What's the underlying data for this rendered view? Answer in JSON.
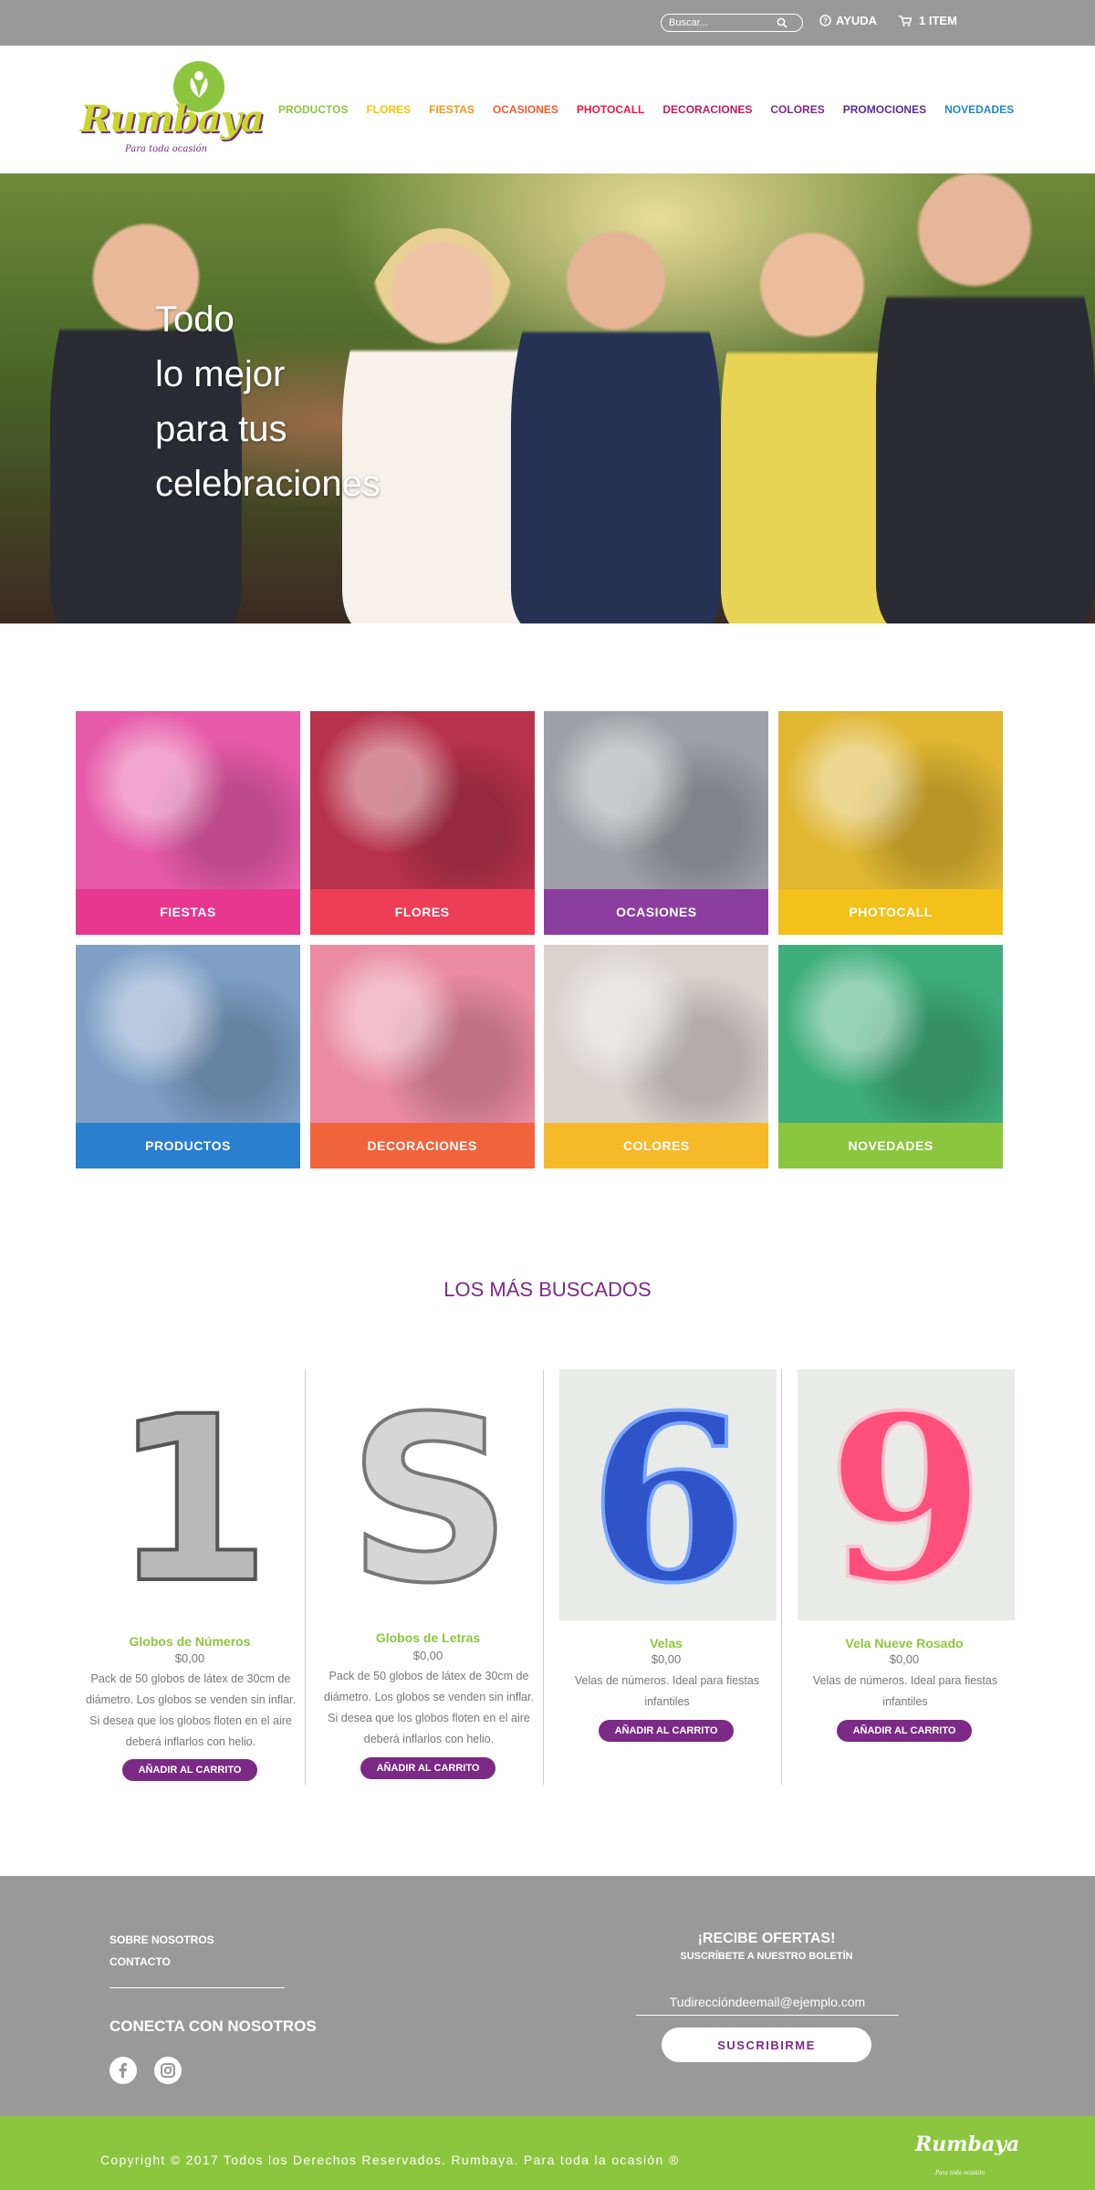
{
  "topbar": {
    "search_placeholder": "Buscar...",
    "help_label": "AYUDA",
    "cart_label": "1 ITEM",
    "icons": [
      "search-icon",
      "help-icon",
      "cart-icon"
    ]
  },
  "brand": {
    "name": "Rumbaya",
    "tagline": "Para toda ocasión",
    "colors": {
      "purple": "#7b2a85",
      "green": "#8cc63f",
      "lime": "#c7d62b",
      "gray": "#999999"
    }
  },
  "nav": [
    {
      "label": "PRODUCTOS",
      "color": "#8cc63f"
    },
    {
      "label": "FLORES",
      "color": "#f5c400"
    },
    {
      "label": "FIESTAS",
      "color": "#f7941d"
    },
    {
      "label": "OCASIONES",
      "color": "#f15a29"
    },
    {
      "label": "PHOTOCALL",
      "color": "#e8174a"
    },
    {
      "label": "DECORACIONES",
      "color": "#c2185b"
    },
    {
      "label": "COLORES",
      "color": "#7b2a85"
    },
    {
      "label": "PROMOCIONES",
      "color": "#5c2d91"
    },
    {
      "label": "NOVEDADES",
      "color": "#1e88c7"
    }
  ],
  "hero": {
    "lines": [
      "Todo",
      "lo mejor",
      "para tus",
      "celebraciones"
    ]
  },
  "categories": [
    {
      "label": "FIESTAS",
      "band": "#e8378f",
      "img": "#e65aa8"
    },
    {
      "label": "FLORES",
      "band": "#ee3d57",
      "img": "#b7324b"
    },
    {
      "label": "OCASIONES",
      "band": "#8c3ea0",
      "img": "#9fa0a6"
    },
    {
      "label": "PHOTOCALL",
      "band": "#f2c21a",
      "img": "#e0b632"
    },
    {
      "label": "PRODUCTOS",
      "band": "#2a7fce",
      "img": "#7f9fc7"
    },
    {
      "label": "DECORACIONES",
      "band": "#f1633a",
      "img": "#ea8aa3"
    },
    {
      "label": "COLORES",
      "band": "#f6b92a",
      "img": "#d9d3d0"
    },
    {
      "label": "NOVEDADES",
      "band": "#8cc63f",
      "img": "#3fae7c"
    }
  ],
  "featured": {
    "title": "LOS MÁS BUSCADOS",
    "products": [
      {
        "name": "Globos de Números",
        "price": "$0,00",
        "desc": "Pack de 50 globos de látex de 30cm de diámetro. Los globos se venden sin inflar. Si desea que los globos floten en el aire deberá inflarlos con helio.",
        "button": "AÑADIR AL CARRITO",
        "glyph": "1"
      },
      {
        "name": "Globos de Letras",
        "price": "$0,00",
        "desc": "Pack de 50 globos de látex de 30cm de diámetro. Los globos se venden sin inflar. Si desea que los globos floten en el aire deberá inflarlos con helio.",
        "button": "AÑADIR AL CARRITO",
        "glyph": "S"
      },
      {
        "name": "Velas",
        "price": "$0,00",
        "desc": "Velas de números. Ideal para fiestas infantiles",
        "button": "AÑADIR AL CARRITO",
        "glyph": "6"
      },
      {
        "name": "Vela Nueve Rosado",
        "price": "$0,00",
        "desc": "Velas de números. Ideal para fiestas infantiles",
        "button": "AÑADIR AL CARRITO",
        "glyph": "9"
      }
    ]
  },
  "footer": {
    "links": [
      "SOBRE NOSOTROS",
      "CONTACTO"
    ],
    "connect": "CONECTA CON NOSOTROS",
    "social": [
      "facebook-icon",
      "instagram-icon"
    ],
    "offers_title": "¡RECIBE OFERTAS!",
    "offers_sub": "SUSCRÍBETE A NUESTRO BOLETÍN",
    "email_placeholder": "Tudireccióndeemail@ejemplo.com",
    "subscribe": "SUSCRIBIRME",
    "copyright": "Copyright © 2017 Todos los Derechos Reservados. Rumbaya. Para toda la ocasión ®",
    "logo": "Rumbaya",
    "logo_tag": "Para toda ocasión"
  }
}
